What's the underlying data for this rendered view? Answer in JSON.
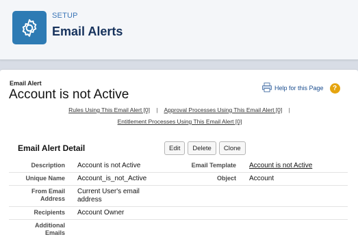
{
  "header": {
    "section": "SETUP",
    "title": "Email Alerts"
  },
  "record": {
    "type_label": "Email Alert",
    "name": "Account is not Active",
    "help_link": "Help for this Page"
  },
  "related_links": {
    "rules": "Rules Using This Email Alert [0]",
    "approval": "Approval Processes Using This Email Alert [0]",
    "entitlement": "Entitlement Processes Using This Email Alert [0]",
    "separator": "|"
  },
  "detail": {
    "title": "Email Alert Detail",
    "buttons": {
      "edit": "Edit",
      "delete": "Delete",
      "clone": "Clone"
    },
    "rows": [
      {
        "label": "Description",
        "value": "Account is not Active",
        "label2": "Email Template",
        "value2": "Account is not Active"
      },
      {
        "label": "Unique Name",
        "value": "Account_is_not_Active",
        "label2": "Object",
        "value2": "Account"
      },
      {
        "label": "From Email Address",
        "value": "Current User's email address",
        "label2": "",
        "value2": ""
      },
      {
        "label": "Recipients",
        "value": "Account Owner",
        "label2": "",
        "value2": ""
      },
      {
        "label": "Additional Emails",
        "value": "",
        "label2": "",
        "value2": ""
      }
    ]
  },
  "colors": {
    "accent": "#2e7bb4",
    "help_badge": "#e5a40e",
    "background": "#d8dde6"
  }
}
